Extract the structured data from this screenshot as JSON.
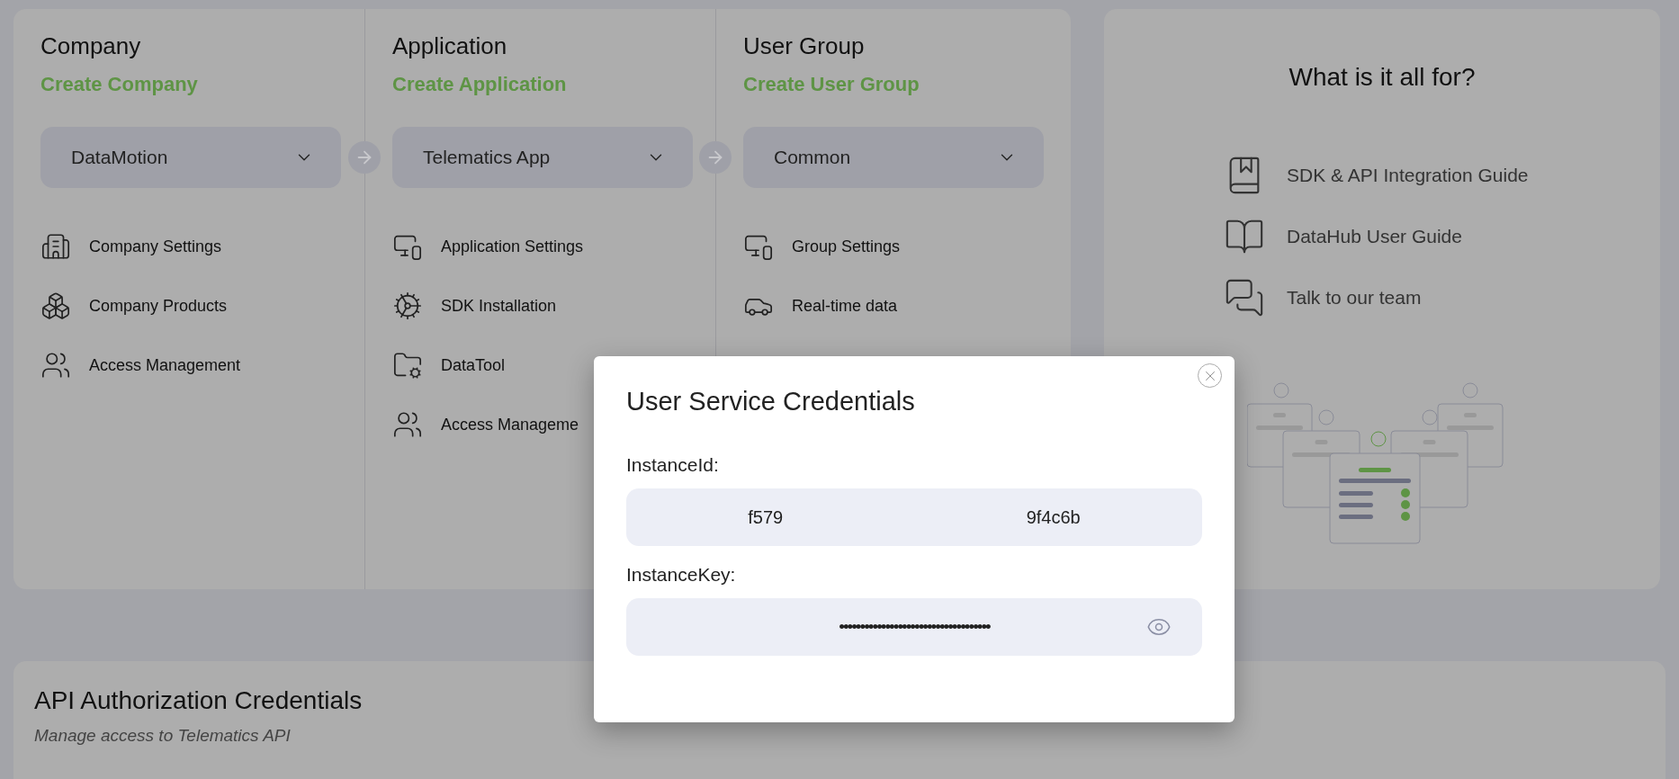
{
  "columns": [
    {
      "title": "Company",
      "create_link": "Create Company",
      "dropdown": {
        "value": "DataMotion"
      },
      "items": [
        "Company Settings",
        "Company Products",
        "Access Management"
      ]
    },
    {
      "title": "Application",
      "create_link": "Create Application",
      "dropdown": {
        "value": "Telematics App"
      },
      "items": [
        "Application Settings",
        "SDK Installation",
        "DataTool",
        "Access Manageme"
      ]
    },
    {
      "title": "User Group",
      "create_link": "Create User Group",
      "dropdown": {
        "value": "Common"
      },
      "items": [
        "Group Settings",
        "Real-time data"
      ]
    }
  ],
  "help_panel": {
    "title": "What is it all for?",
    "links": [
      "SDK & API Integration Guide",
      "DataHub User Guide",
      "Talk to our team"
    ]
  },
  "api_section": {
    "title": "API Authorization Credentials",
    "subtitle": "Manage access to Telematics API"
  },
  "modal": {
    "title": "User Service Credentials",
    "fields": [
      {
        "kind": "split",
        "label": "InstanceId:",
        "value_parts": [
          "f579",
          "9f4c6b"
        ]
      },
      {
        "kind": "secret",
        "label": "InstanceKey:",
        "value": "••••••••••••••••••••••••••••••••••••"
      }
    ]
  }
}
